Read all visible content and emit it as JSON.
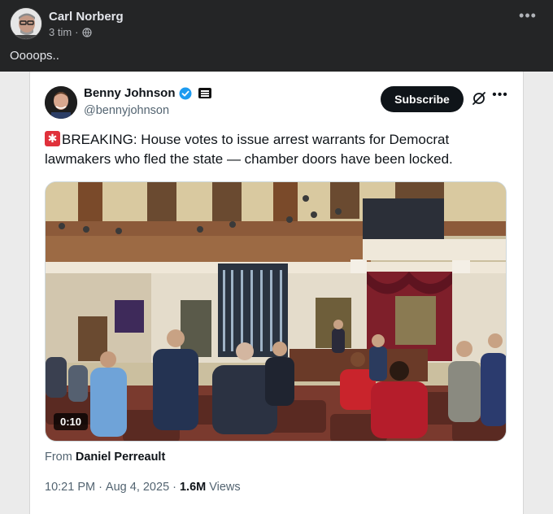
{
  "post": {
    "author": "Carl Norberg",
    "time": "3 tim",
    "separator": "·",
    "privacy_icon": "globe-icon",
    "text": "Oooops.."
  },
  "tweet": {
    "display_name": "Benny Johnson",
    "handle": "@bennyjohnson",
    "subscribe_label": "Subscribe",
    "text": "BREAKING: House votes to issue arrest warrants for Democrat lawmakers who fled the state — chamber doors have been locked.",
    "video_duration": "0:10",
    "from_prefix": "From",
    "from_name": "Daniel Perreault",
    "time": "10:21 PM",
    "dot": "·",
    "date": "Aug 4, 2025",
    "views_count": "1.6M",
    "views_label": "Views"
  },
  "colors": {
    "facebook_dark_bg": "#242526",
    "verified_blue": "#1d9bf0",
    "subscribe_bg": "#0f1419",
    "siren_red": "#e0313b"
  }
}
